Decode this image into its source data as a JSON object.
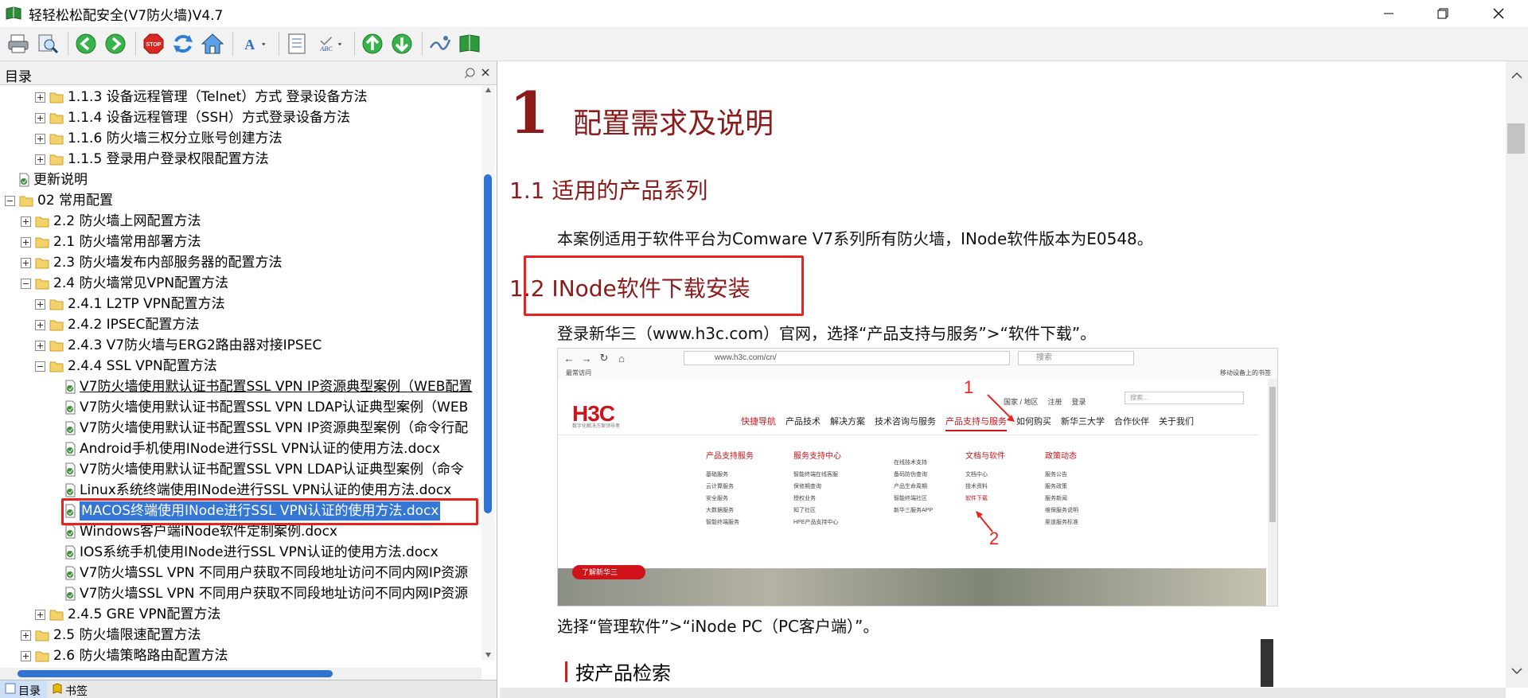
{
  "window": {
    "title": "轻轻松松配安全(V7防火墙)V4.7"
  },
  "toolbar": {
    "buttons": [
      "print-icon",
      "find-icon",
      "back-icon",
      "forward-icon",
      "stop-icon",
      "refresh-icon",
      "home-icon",
      "font-icon",
      "options-icon",
      "spellcheck-icon",
      "previous-icon",
      "next-icon",
      "locate-icon",
      "book-icon"
    ],
    "stop_label": "STOP",
    "abc_label": "ABC"
  },
  "sidebar": {
    "title": "目录",
    "items": [
      {
        "level": 2,
        "type": "folder",
        "expander": "plus",
        "label": "1.1.3 设备远程管理（Telnet）方式 登录设备方法"
      },
      {
        "level": 2,
        "type": "folder",
        "expander": "plus",
        "label": "1.1.4 设备远程管理（SSH）方式登录设备方法"
      },
      {
        "level": 2,
        "type": "folder",
        "expander": "plus",
        "label": "1.1.6 防火墙三权分立账号创建方法"
      },
      {
        "level": 2,
        "type": "folder",
        "expander": "plus",
        "label": "1.1.5 登录用户登录权限配置方法"
      },
      {
        "level": 0,
        "type": "doc",
        "expander": "none",
        "label": "更新说明"
      },
      {
        "level": 0,
        "type": "folder",
        "expander": "minus",
        "label": "02 常用配置"
      },
      {
        "level": 1,
        "type": "folder",
        "expander": "plus",
        "label": "2.2 防火墙上网配置方法"
      },
      {
        "level": 1,
        "type": "folder",
        "expander": "plus",
        "label": "2.1 防火墙常用部署方法"
      },
      {
        "level": 1,
        "type": "folder",
        "expander": "plus",
        "label": "2.3 防火墙发布内部服务器的配置方法"
      },
      {
        "level": 1,
        "type": "folder",
        "expander": "minus",
        "label": "2.4 防火墙常见VPN配置方法"
      },
      {
        "level": 2,
        "type": "folder",
        "expander": "plus",
        "label": "2.4.1 L2TP VPN配置方法"
      },
      {
        "level": 2,
        "type": "folder",
        "expander": "plus",
        "label": "2.4.2 IPSEC配置方法"
      },
      {
        "level": 2,
        "type": "folder",
        "expander": "plus",
        "label": "2.4.3 V7防火墙与ERG2路由器对接IPSEC"
      },
      {
        "level": 2,
        "type": "folder",
        "expander": "minus",
        "label": "2.4.4 SSL VPN配置方法"
      },
      {
        "level": 3,
        "type": "doc",
        "expander": "none",
        "label": "V7防火墙使用默认证书配置SSL VPN IP资源典型案例（WEB配置",
        "link": true
      },
      {
        "level": 3,
        "type": "doc",
        "expander": "none",
        "label": "V7防火墙使用默认证书配置SSL VPN LDAP认证典型案例（WEB"
      },
      {
        "level": 3,
        "type": "doc",
        "expander": "none",
        "label": "V7防火墙使用默认证书配置SSL VPN IP资源典型案例（命令行配"
      },
      {
        "level": 3,
        "type": "doc",
        "expander": "none",
        "label": "Android手机使用INode进行SSL VPN认证的使用方法.docx"
      },
      {
        "level": 3,
        "type": "doc",
        "expander": "none",
        "label": "V7防火墙使用默认证书配置SSL VPN LDAP认证典型案例（命令"
      },
      {
        "level": 3,
        "type": "doc",
        "expander": "none",
        "label": "Linux系统终端使用INode进行SSL VPN认证的使用方法.docx"
      },
      {
        "level": 3,
        "type": "doc",
        "expander": "none",
        "label": "MACOS终端使用INode进行SSL VPN认证的使用方法.docx",
        "selected": true
      },
      {
        "level": 3,
        "type": "doc",
        "expander": "none",
        "label": "Windows客户端iNode软件定制案例.docx"
      },
      {
        "level": 3,
        "type": "doc",
        "expander": "none",
        "label": "IOS系统手机使用INode进行SSL VPN认证的使用方法.docx"
      },
      {
        "level": 3,
        "type": "doc",
        "expander": "none",
        "label": "V7防火墙SSL VPN 不同用户获取不同段地址访问不同内网IP资源"
      },
      {
        "level": 3,
        "type": "doc",
        "expander": "none",
        "label": "V7防火墙SSL VPN 不同用户获取不同段地址访问不同内网IP资源"
      },
      {
        "level": 2,
        "type": "folder",
        "expander": "plus",
        "label": "2.4.5 GRE VPN配置方法"
      },
      {
        "level": 1,
        "type": "folder",
        "expander": "plus",
        "label": "2.5 防火墙限速配置方法"
      },
      {
        "level": 1,
        "type": "folder",
        "expander": "plus",
        "label": "2.6 防火墙策略路由配置方法"
      }
    ],
    "tabs": [
      {
        "label": "目录",
        "active": true
      },
      {
        "label": "书签",
        "active": false
      }
    ]
  },
  "document": {
    "h1_number": "1",
    "h1_text": "配置需求及说明",
    "s11_title": "1.1  适用的产品系列",
    "s11_para": "本案例适用于软件平台为Comware V7系列所有防火墙，INode软件版本为E0548。",
    "s12_title": "1.2  INode软件下载安装",
    "s12_para1": "登录新华三（www.h3c.com）官网，选择“产品支持与服务”>“软件下载”。",
    "s12_para2": "选择“管理软件”>“iNode PC（PC客户端）”。",
    "subsection": "按产品检索"
  },
  "screenshot": {
    "url": "www.h3c.com/cn/",
    "search_placeholder": "搜索",
    "bookmark": "最常访问",
    "mobile_bookmark": "移动设备上的书签",
    "logo": "H3C",
    "logo_sub": "数字化解决方案领导者",
    "toplinks": [
      "国家 / 地区",
      "注册",
      "登录"
    ],
    "site_search": "搜索...",
    "nav": [
      "快捷导航",
      "产品技术",
      "解决方案",
      "技术咨询与服务",
      "产品支持与服务",
      "如何购买",
      "新华三大学",
      "合作伙伴",
      "关于我们"
    ],
    "columns": [
      {
        "heading": "产品支持服务",
        "items": [
          "基础服务",
          "云计算服务",
          "安全服务",
          "大数据服务",
          "智能终端服务"
        ]
      },
      {
        "heading": "服务支持中心",
        "items": [
          "智能终端在线客服",
          "保修期查询",
          "授权业务",
          "知了社区",
          "HPE产品支持中心"
        ]
      },
      {
        "heading": "",
        "items": [
          "在线技术支持",
          "备码防伪查询",
          "产品生命周期",
          "智能终端社区",
          "新华三服务APP"
        ]
      },
      {
        "heading": "文档与软件",
        "items": [
          "文档中心",
          "技术资料",
          "软件下载"
        ]
      },
      {
        "heading": "政策动态",
        "items": [
          "服务公告",
          "服务政策",
          "服务新闻",
          "维保服务说明",
          "渠道服务标准"
        ]
      }
    ],
    "banner_button": "了解新华三",
    "annotation_1": "1",
    "annotation_2": "2"
  }
}
